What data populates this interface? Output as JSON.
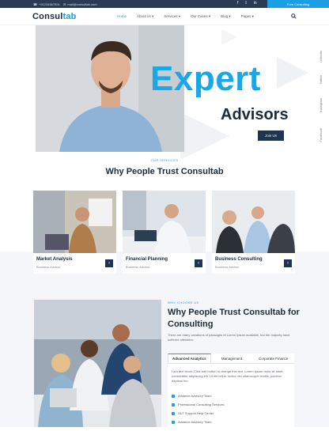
{
  "topbar": {
    "phone": "+91234567891",
    "email": "mail@consultab.com",
    "cta": "Free Consulting"
  },
  "nav": {
    "logo_a": "Consul",
    "logo_b": "tab",
    "items": [
      "Home",
      "About us ▾",
      "Services ▾",
      "Our Cases ▾",
      "Blog ▾",
      "Pages ▾"
    ]
  },
  "hero": {
    "headline": "Expert",
    "subheadline": "Advisors",
    "button": "Join Us",
    "social": [
      "Linkedin",
      "Twitter",
      "Instagram",
      "Facebook"
    ]
  },
  "services": {
    "eyebrow": "OUR SERVICES",
    "title": "Why People Trust Consultab",
    "cards": [
      {
        "title": "Market Analysis",
        "sub": "Business Advisor"
      },
      {
        "title": "Financial Planning",
        "sub": "Business Advisor"
      },
      {
        "title": "Business Consulting",
        "sub": "Business Advisor"
      }
    ]
  },
  "why": {
    "eyebrow": "WHY CHOOSE US",
    "title": "Why People Trust Consultab for Consulting",
    "paragraph": "There are many variations of passages of Lorem Ipsum available, but the majority have suffered alteration.",
    "tabs": [
      "Advanced Analytics",
      "Management",
      "Corporate Finance"
    ],
    "tab_text": "I am text block. Click edit button to change this text. Lorem ipsum dolor sit amet, consectetur adipiscing elit. Ut elit tellus, luctus nec ullamcorper mattis, pulvinar dapibus leo.",
    "features": [
      "Advance Advisory Team",
      "Professional Consulting Services",
      "24/7 Support Help Center",
      "Advance Advisory Team"
    ]
  },
  "colors": {
    "accent": "#1a9ee6",
    "dark": "#1d3553"
  }
}
